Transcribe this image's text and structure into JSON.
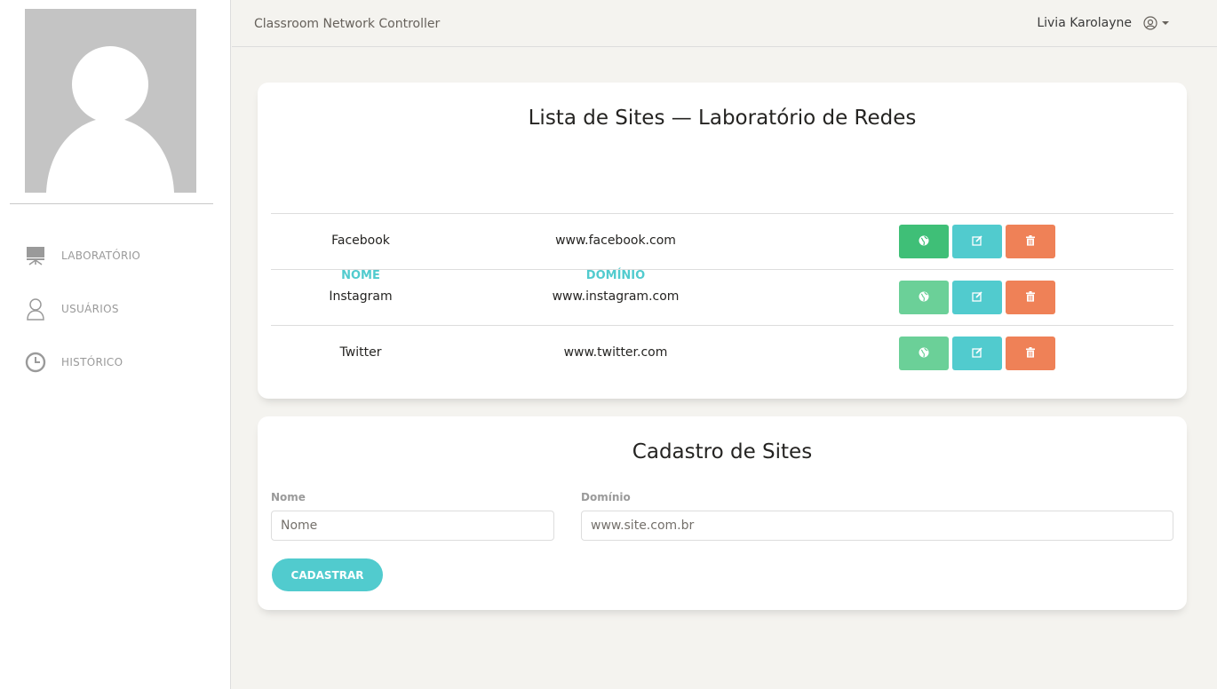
{
  "navbar": {
    "brand": "Classroom Network Controller",
    "user_name": "Livia Karolayne"
  },
  "sidebar": {
    "items": [
      {
        "label": "LABORATÓRIO",
        "icon": "monitor-icon"
      },
      {
        "label": "USUÁRIOS",
        "icon": "user-icon"
      },
      {
        "label": "HISTÓRICO",
        "icon": "clock-icon"
      }
    ]
  },
  "list": {
    "title": "Lista de Sites — Laboratório de Redes",
    "headers": {
      "name": "NOME",
      "domain": "DOMÍNIO"
    },
    "rows": [
      {
        "name": "Facebook",
        "domain": "www.facebook.com"
      },
      {
        "name": "Instagram",
        "domain": "www.instagram.com"
      },
      {
        "name": "Twitter",
        "domain": "www.twitter.com"
      }
    ],
    "actions": [
      "globe-icon",
      "edit-icon",
      "trash-icon"
    ]
  },
  "form": {
    "title": "Cadastro de Sites",
    "name_label": "Nome",
    "name_placeholder": "Nome",
    "domain_label": "Domínio",
    "domain_placeholder": "www.site.com.br",
    "submit_label": "CADASTRAR"
  },
  "colors": {
    "accent": "#51cbce",
    "success": "#6bd098",
    "success_active": "#3fbf77",
    "danger": "#ef8157"
  }
}
